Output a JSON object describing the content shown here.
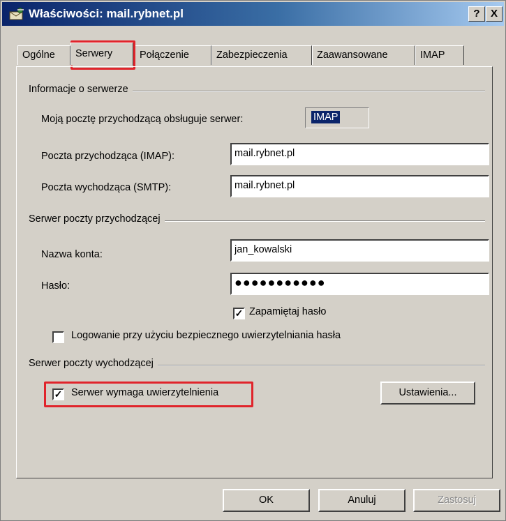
{
  "window": {
    "title": "Właściwości: mail.rybnet.pl",
    "help_label": "?",
    "close_label": "X",
    "app_icon": "envelope-icon"
  },
  "tabs": [
    {
      "label": "Ogólne"
    },
    {
      "label": "Serwery",
      "active": true
    },
    {
      "label": "Połączenie"
    },
    {
      "label": "Zabezpieczenia"
    },
    {
      "label": "Zaawansowane"
    },
    {
      "label": "IMAP"
    }
  ],
  "server_info": {
    "title": "Informacje o serwerze",
    "incoming_type_label": "Moją pocztę przychodzącą obsługuje serwer:",
    "incoming_type_value": "IMAP",
    "incoming_label": "Poczta przychodząca (IMAP):",
    "incoming_value": "mail.rybnet.pl",
    "outgoing_label": "Poczta wychodząca (SMTP):",
    "outgoing_value": "mail.rybnet.pl"
  },
  "incoming_server": {
    "title": "Serwer poczty przychodzącej",
    "account_label": "Nazwa konta:",
    "account_value": "jan_kowalski",
    "password_label": "Hasło:",
    "password_value": "●●●●●●●●●●●",
    "remember_label": "Zapamiętaj hasło",
    "remember_checked": true,
    "spa_label": "Logowanie przy użyciu bezpiecznego uwierzytelniania hasła",
    "spa_checked": false
  },
  "outgoing_server": {
    "title": "Serwer poczty wychodzącej",
    "auth_label": "Serwer wymaga uwierzytelnienia",
    "auth_checked": true,
    "settings_label": "Ustawienia..."
  },
  "footer": {
    "ok_label": "OK",
    "cancel_label": "Anuluj",
    "apply_label": "Zastosuj"
  },
  "colors": {
    "highlight": "#e0242b",
    "title_gradient_start": "#0a246a",
    "title_gradient_end": "#a6caf0",
    "selected_text_bg": "#0a246a"
  }
}
